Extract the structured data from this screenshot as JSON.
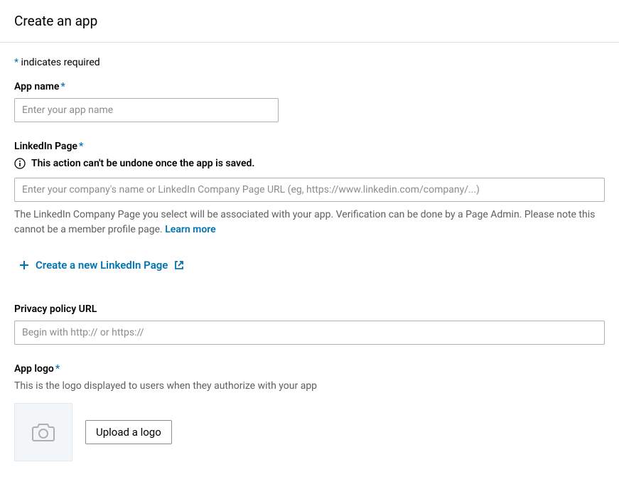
{
  "header": {
    "title": "Create an app"
  },
  "required_note_asterisk": "*",
  "required_note_text": " indicates required",
  "fields": {
    "app_name": {
      "label": "App name",
      "placeholder": "Enter your app name"
    },
    "linkedin_page": {
      "label": "LinkedIn Page",
      "warning": "This action can't be undone once the app is saved.",
      "placeholder": "Enter your company's name or LinkedIn Company Page URL (eg, https://www.linkedin.com/company/...)",
      "help_text": "The LinkedIn Company Page you select will be associated with your app. Verification can be done by a Page Admin. Please note this cannot be a member profile page. ",
      "learn_more": "Learn more",
      "create_new_link": "Create a new LinkedIn Page"
    },
    "privacy_url": {
      "label": "Privacy policy URL",
      "placeholder": "Begin with http:// or https://"
    },
    "app_logo": {
      "label": "App logo",
      "description": "This is the logo displayed to users when they authorize with your app",
      "upload_button": "Upload a logo"
    }
  }
}
